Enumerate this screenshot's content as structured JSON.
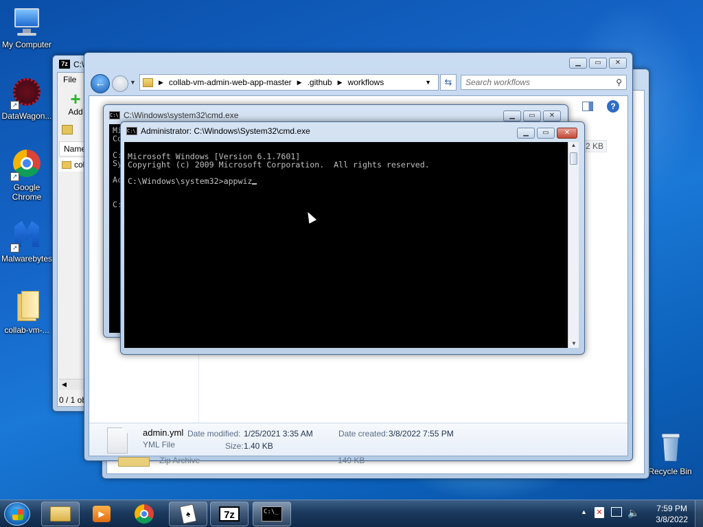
{
  "desktop": {
    "icons": [
      {
        "label": "My Computer"
      },
      {
        "label": "DataWagon..."
      },
      {
        "label": "Google Chrome"
      },
      {
        "label": "Malwarebytes"
      },
      {
        "label": "collab-vm-..."
      },
      {
        "label": "Recycle Bin"
      }
    ]
  },
  "sevenzip": {
    "title": "C:\\",
    "menu_file": "File",
    "add_label": "Add",
    "column_name": "Name",
    "row_folder": "coll",
    "status": "0 / 1 ob"
  },
  "explorer": {
    "breadcrumb": [
      "collab-vm-admin-web-app-master",
      ".github",
      "workflows"
    ],
    "search_placeholder": "Search workflows",
    "size_fragment": "2 KB",
    "details": {
      "filename": "admin.yml",
      "filetype": "YML File",
      "modified_label": "Date modified:",
      "modified_value": "1/25/2021 3:35 AM",
      "size_label": "Size:",
      "size_value": "1.40 KB",
      "created_label": "Date created:",
      "created_value": "3/8/2022 7:55 PM"
    },
    "under_row": {
      "type": "Zip Archive",
      "size": "149 KB"
    }
  },
  "cmd_back": {
    "title": "C:\\Windows\\system32\\cmd.exe",
    "left_chars": "Mi\nCo\n\nC:\nSy\n\nAc\n\n\nC:"
  },
  "cmd_front": {
    "title": "Administrator: C:\\Windows\\System32\\cmd.exe",
    "line1": "Microsoft Windows [Version 6.1.7601]",
    "line2": "Copyright (c) 2009 Microsoft Corporation.  All rights reserved.",
    "prompt": "C:\\Windows\\system32>appwiz"
  },
  "taskbar": {
    "time": "7:59 PM",
    "date": "3/8/2022",
    "sevenzip_label": "7z",
    "cmd_label": "C:\\_"
  },
  "colors": {
    "desktop_blue": "#1565c8",
    "console_bg": "#000000",
    "console_text": "#c0c0c0",
    "close_red": "#c24a36"
  }
}
